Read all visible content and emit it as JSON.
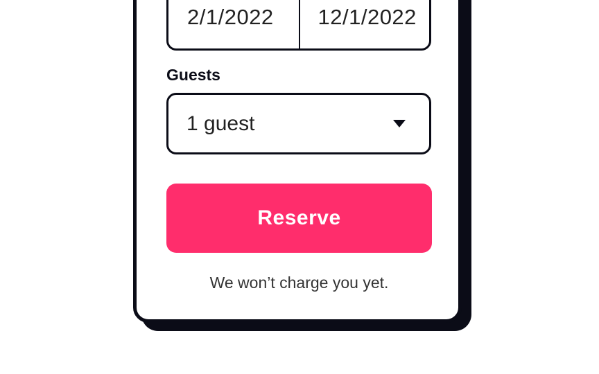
{
  "booking": {
    "checkin_date": "2/1/2022",
    "checkout_date": "12/1/2022",
    "guests_label": "Guests",
    "guests_value": "1 guest",
    "reserve_label": "Reserve",
    "charge_note": "We won’t charge you yet."
  },
  "colors": {
    "accent": "#ff2d6c",
    "border": "#0b0c17",
    "background": "#ffffff"
  },
  "icons": {
    "guests_dropdown": "caret-down-icon"
  }
}
